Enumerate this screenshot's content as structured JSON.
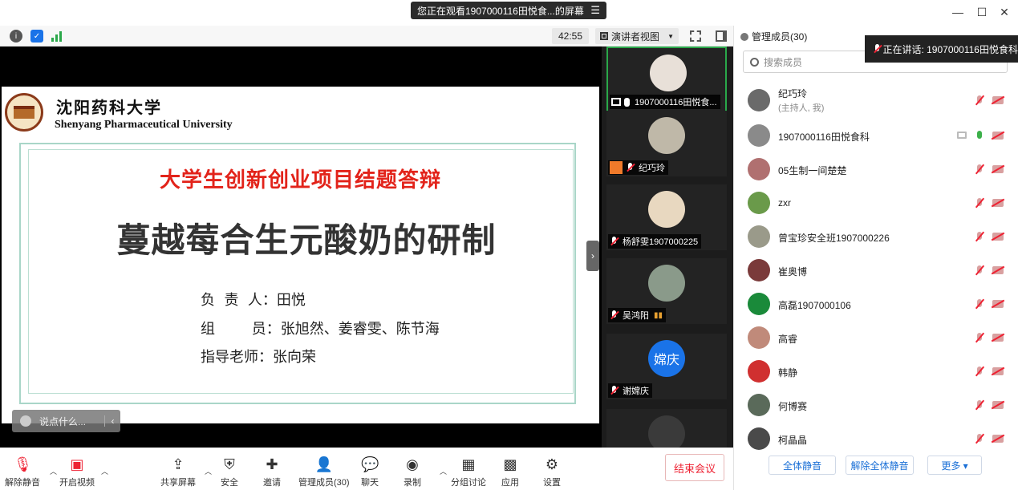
{
  "window": {
    "share_banner": "您正在观看1907000116田悦食...的屏幕",
    "menu_icon": "menu-lines-icon",
    "controls": [
      "minimize-icon",
      "maximize-icon",
      "close-icon"
    ]
  },
  "top_toolbar": {
    "icons": [
      "info-icon",
      "shield-icon",
      "signal-icon"
    ],
    "timer": "42:55",
    "view_mode": "演讲者视图"
  },
  "slide": {
    "univ_cn": "沈阳药科大学",
    "univ_en": "Shenyang Pharmaceutical University",
    "subtitle": "大学生创新创业项目结题答辩",
    "title": "蔓越莓合生元酸奶的研制",
    "lines": [
      "负  责  人：田悦",
      "组        员：张旭然、姜睿雯、陈节海",
      "指导老师：张向荣"
    ],
    "chat_hint": "说点什么..."
  },
  "video_tiles": [
    {
      "name": "1907000116田悦食..."
    },
    {
      "name": "纪巧玲"
    },
    {
      "name": "杨舒雯1907000225"
    },
    {
      "name": "吴鸿阳"
    },
    {
      "name": "谢嫦庆",
      "initials": "嫦庆"
    },
    {
      "name": ""
    }
  ],
  "panel": {
    "title": "管理成员(30)",
    "search_placeholder": "搜索成员",
    "speaking": "正在讲话: 1907000116田悦食科",
    "participants": [
      {
        "name": "纪巧玲",
        "sub": "(主持人, 我)",
        "mic": "muted",
        "color": "#6a6a6a"
      },
      {
        "name": "1907000116田悦食科",
        "sub": "",
        "mic": "live",
        "color": "#8a8a8a"
      },
      {
        "name": "05生制一间楚楚",
        "sub": "",
        "mic": "muted",
        "color": "#b07070"
      },
      {
        "name": "zxr",
        "sub": "",
        "mic": "muted",
        "color": "#6a9a4a"
      },
      {
        "name": "曾宝珍安全班1907000226",
        "sub": "",
        "mic": "muted",
        "color": "#9a9a8a"
      },
      {
        "name": "崔奥博",
        "sub": "",
        "mic": "muted",
        "color": "#7a3a3a"
      },
      {
        "name": "高磊1907000106",
        "sub": "",
        "mic": "muted",
        "color": "#1a8a3a"
      },
      {
        "name": "高睿",
        "sub": "",
        "mic": "muted",
        "color": "#c08a7a"
      },
      {
        "name": "韩静",
        "sub": "",
        "mic": "muted",
        "color": "#d03030"
      },
      {
        "name": "何博赛",
        "sub": "",
        "mic": "muted",
        "color": "#5a6a5a"
      },
      {
        "name": "柯晶晶",
        "sub": "",
        "mic": "muted",
        "color": "#4a4a4a"
      }
    ],
    "buttons": {
      "mute_all": "全体静音",
      "unmute_all": "解除全体静音",
      "more": "更多 ▾"
    }
  },
  "bottom_bar": {
    "tools": [
      {
        "label": "解除静音",
        "icon": "mic-muted-icon"
      },
      {
        "label": "开启视频",
        "icon": "camera-off-icon"
      },
      {
        "label": "共享屏幕",
        "icon": "share-screen-icon"
      },
      {
        "label": "安全",
        "icon": "shield-icon"
      },
      {
        "label": "邀请",
        "icon": "invite-icon"
      },
      {
        "label": "管理成员(30)",
        "icon": "members-icon"
      },
      {
        "label": "聊天",
        "icon": "chat-icon"
      },
      {
        "label": "录制",
        "icon": "record-icon"
      },
      {
        "label": "分组讨论",
        "icon": "breakout-icon"
      },
      {
        "label": "应用",
        "icon": "apps-icon"
      },
      {
        "label": "设置",
        "icon": "settings-icon"
      }
    ],
    "end_meeting": "结束会议"
  }
}
